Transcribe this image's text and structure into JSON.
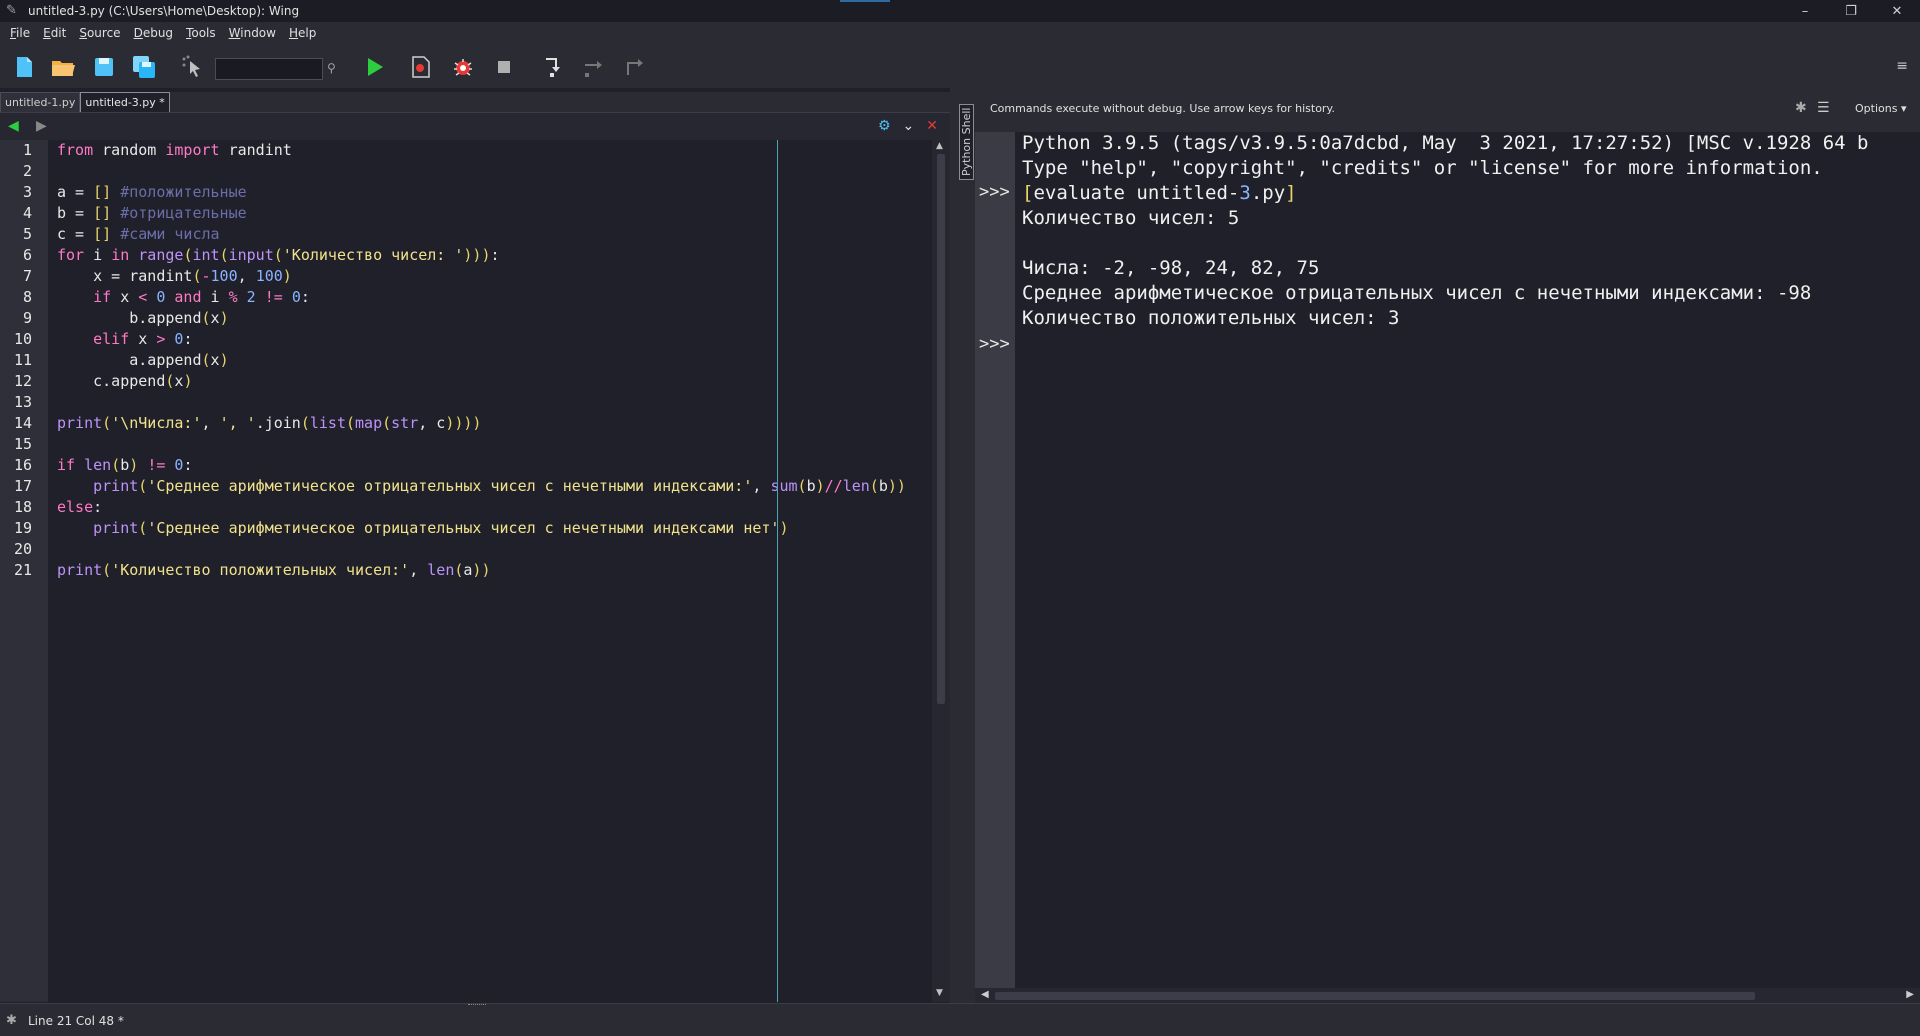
{
  "window": {
    "title": "untitled-3.py (C:\\Users\\Home\\Desktop): Wing",
    "min": "–",
    "max": "❐",
    "close": "✕"
  },
  "menu": {
    "items": [
      {
        "label": "File",
        "u": "F",
        "rest": "ile"
      },
      {
        "label": "Edit",
        "u": "E",
        "rest": "dit"
      },
      {
        "label": "Source",
        "u": "S",
        "rest": "ource"
      },
      {
        "label": "Debug",
        "u": "D",
        "rest": "ebug"
      },
      {
        "label": "Tools",
        "u": "T",
        "rest": "ools"
      },
      {
        "label": "Window",
        "u": "W",
        "rest": "indow"
      },
      {
        "label": "Help",
        "u": "H",
        "rest": "elp"
      }
    ]
  },
  "toolbar": {
    "search_value": "",
    "menu_glyph": "≡"
  },
  "editor": {
    "tabs": [
      {
        "label": "untitled-1.py",
        "active": false
      },
      {
        "label": "untitled-3.py *",
        "active": true
      }
    ],
    "line_numbers": [
      "1",
      "2",
      "3",
      "4",
      "5",
      "6",
      "7",
      "8",
      "9",
      "10",
      "11",
      "12",
      "13",
      "14",
      "15",
      "16",
      "17",
      "18",
      "19",
      "20",
      "21"
    ]
  },
  "shell": {
    "tab_label": "Python Shell",
    "note": "Commands execute without debug.  Use arrow keys for history.",
    "options_label": "Options",
    "prompts": [
      ">>>",
      ">>>"
    ],
    "output": {
      "banner1": "Python 3.9.5 (tags/v3.9.5:0a7dcbd, May  3 2021, 17:27:52) [MSC v.1928 64 b",
      "banner2": "Type \"help\", \"copyright\", \"credits\" or \"license\" for more information.",
      "eval_prefix": "[",
      "eval_name": "evaluate untitled-",
      "eval_num": "3",
      "eval_ext": ".py",
      "eval_suffix": "]",
      "line_count": "Количество чисел: 5",
      "line_numbers": "Числа: -2, -98, 24, 82, 75",
      "line_avg": "Среднее арифметическое отрицательных чисел с нечетными индексами: -98",
      "line_pos": "Количество положительных чисел: 3"
    }
  },
  "status": {
    "text": "Line 21 Col 48 *"
  }
}
